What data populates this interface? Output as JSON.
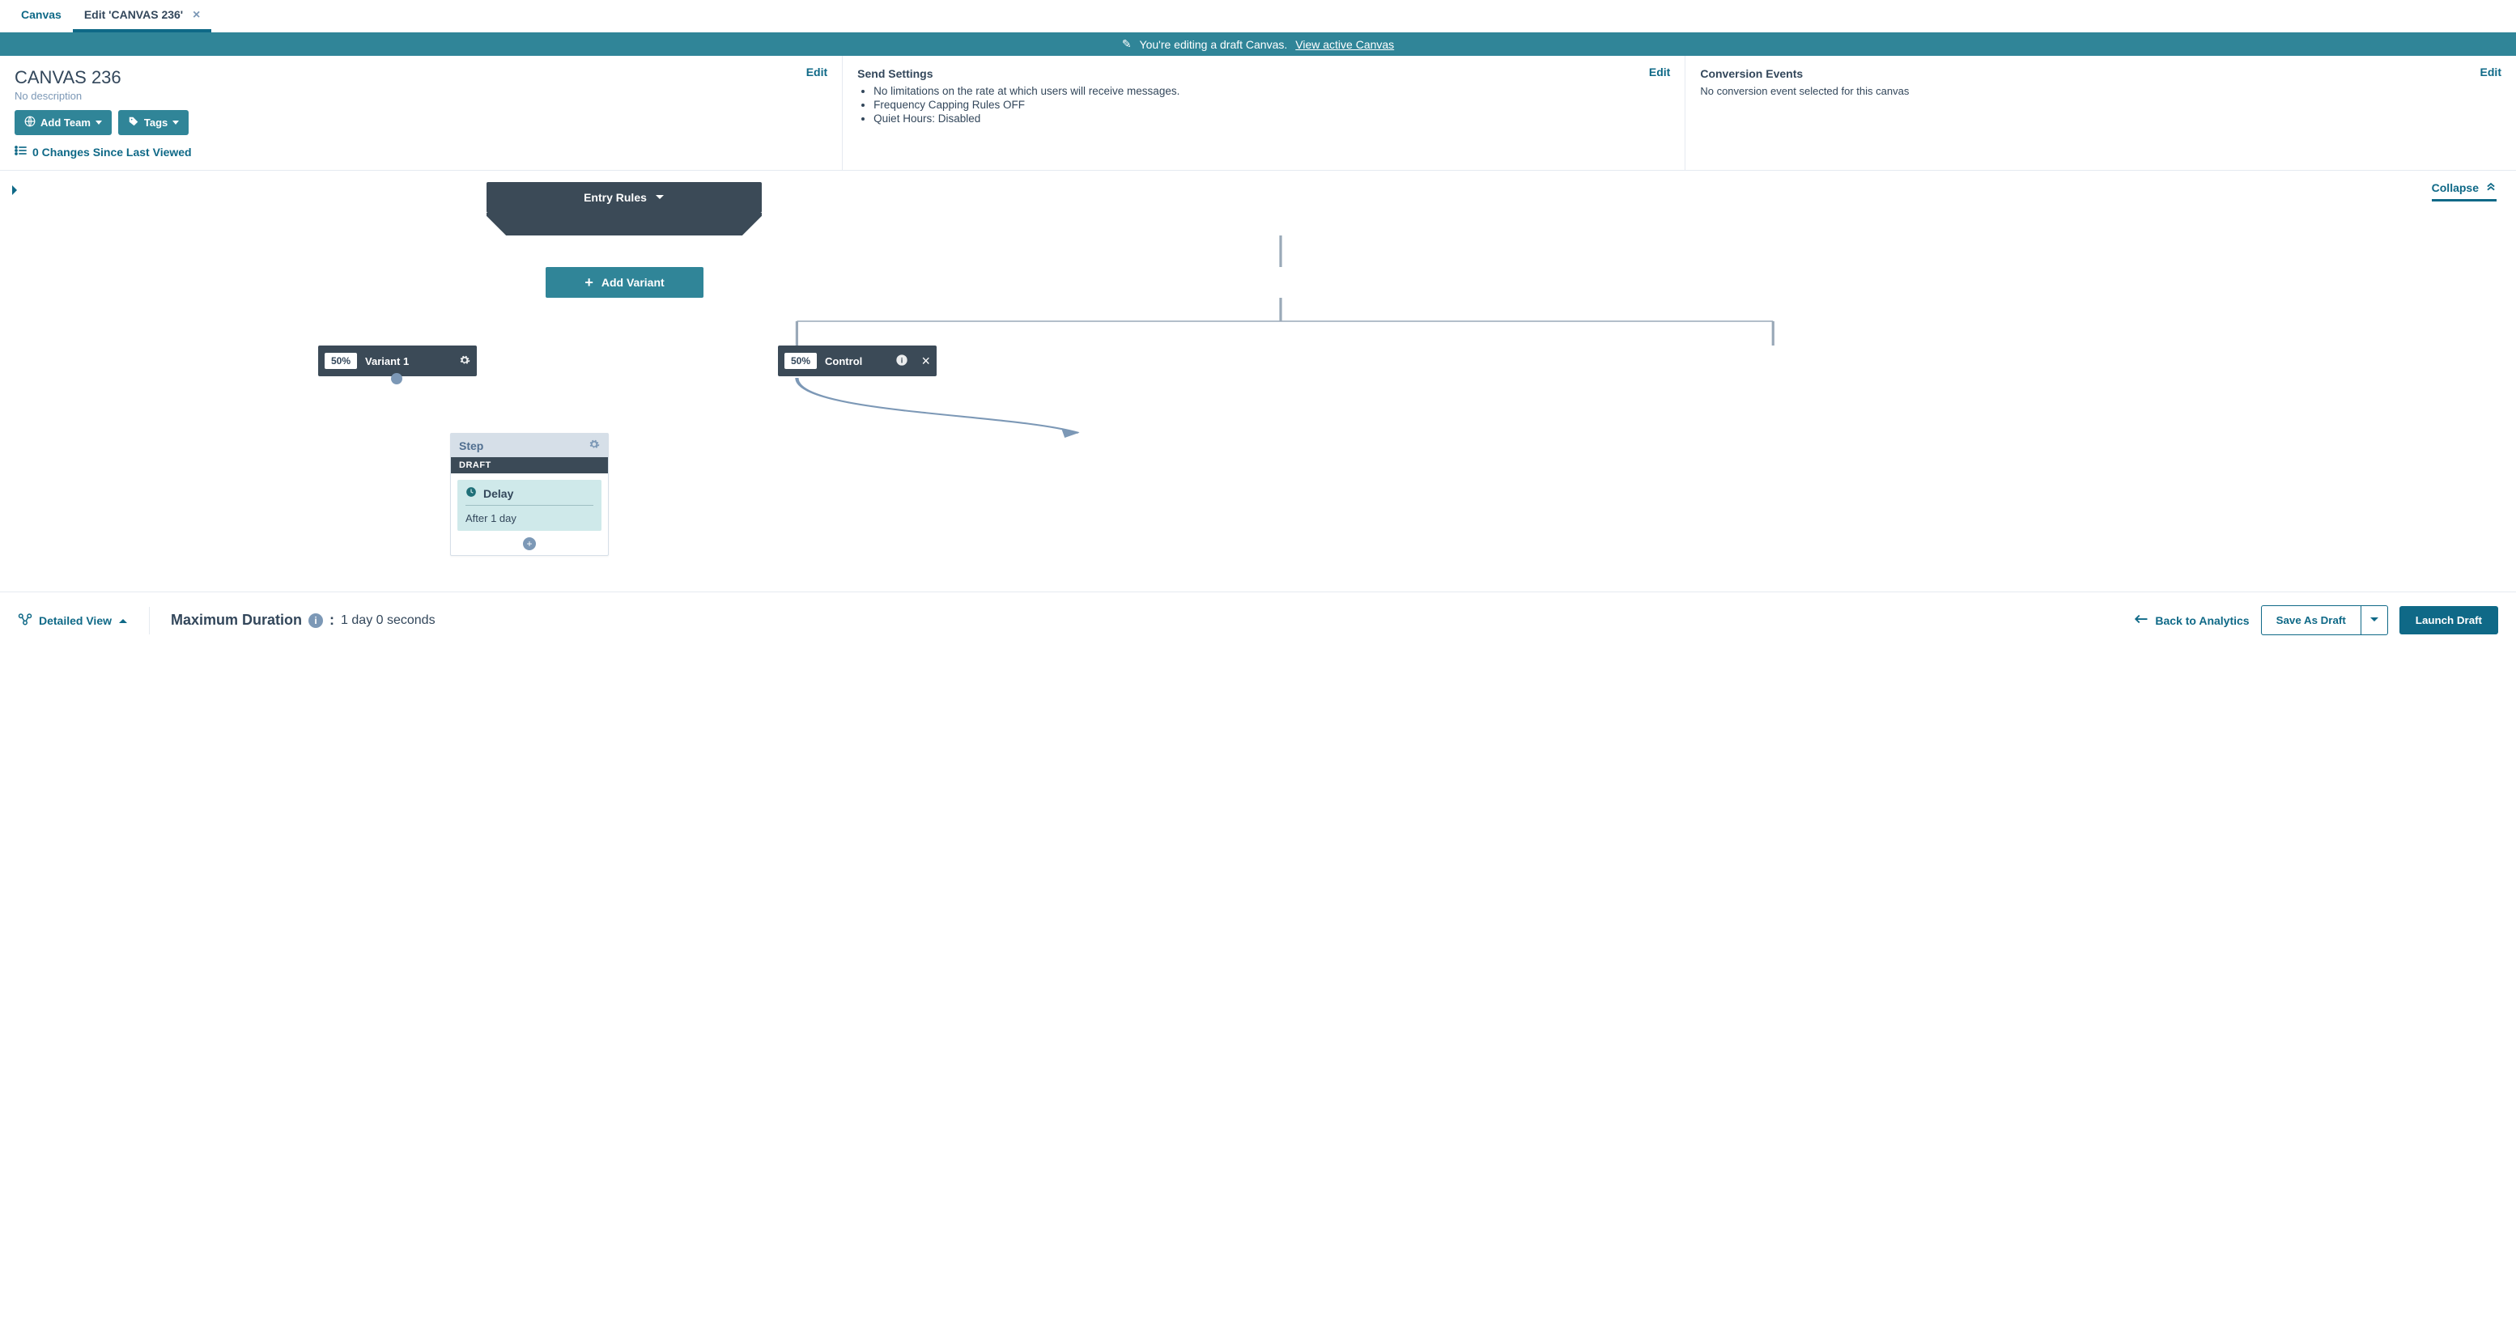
{
  "tabs": {
    "canvas": "Canvas",
    "edit": "Edit 'CANVAS 236'"
  },
  "banner": {
    "text": "You're editing a draft Canvas.",
    "link": "View active Canvas"
  },
  "panel1": {
    "edit": "Edit",
    "title": "CANVAS 236",
    "nodesc": "No description",
    "addTeam": "Add Team",
    "tags": "Tags",
    "changes": "0 Changes Since Last Viewed"
  },
  "panel2": {
    "edit": "Edit",
    "header": "Send Settings",
    "b1": "No limitations on the rate at which users will receive messages.",
    "b2": "Frequency Capping Rules OFF",
    "b3": "Quiet Hours: Disabled"
  },
  "panel3": {
    "edit": "Edit",
    "header": "Conversion Events",
    "desc": "No conversion event selected for this canvas"
  },
  "workspace": {
    "collapse": "Collapse",
    "entry": "Entry Rules",
    "addVariant": "Add Variant",
    "variant1": {
      "pct": "50%",
      "name": "Variant 1"
    },
    "control": {
      "pct": "50%",
      "name": "Control"
    },
    "step": {
      "title": "Step",
      "draft": "DRAFT",
      "delayLabel": "Delay",
      "delayBody": "After 1 day"
    }
  },
  "footer": {
    "detailed": "Detailed View",
    "maxdurLabel": "Maximum Duration",
    "maxdurSep": " : ",
    "maxdurVal": "1 day 0 seconds",
    "back": "Back to Analytics",
    "saveDraft": "Save As Draft",
    "launch": "Launch Draft"
  }
}
